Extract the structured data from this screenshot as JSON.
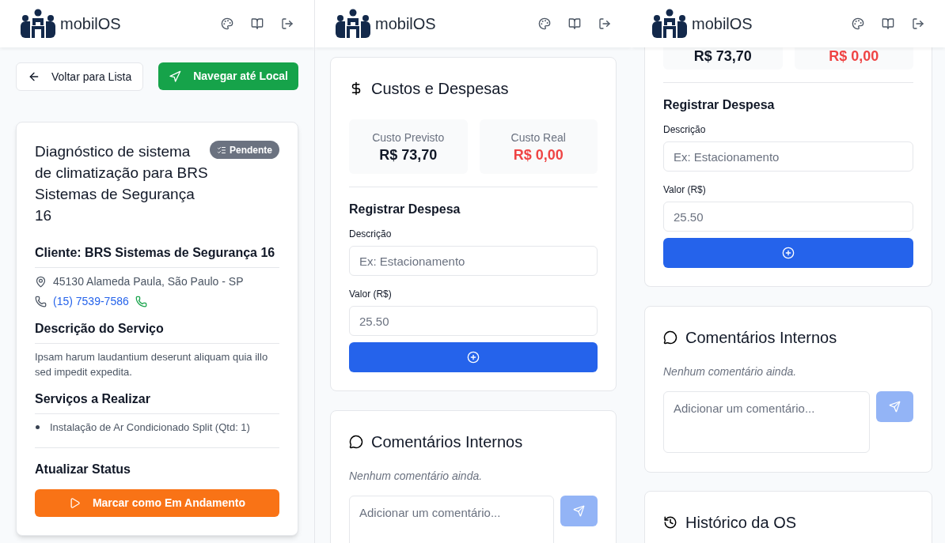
{
  "panels": [
    {
      "kind": "details",
      "app_name": "mobilOS",
      "back_button": "Voltar para Lista",
      "navigate_button": "Navegar até Local",
      "title": "Diagnóstico de sistema de climatização para BRS Sistemas de Segurança 16",
      "status_badge": "Pendente",
      "client": "Cliente: BRS Sistemas de Segurança 16",
      "address": "45130 Alameda Paula, São Paulo - SP",
      "phone": "(15) 7539-7586",
      "description_heading": "Descrição do Serviço",
      "description": "Ipsam harum laudantium deserunt aliquam quia illo sed impedit expedita.",
      "services_heading": "Serviços a Realizar",
      "services": [
        "Instalação de Ar Condicionado Split (Qtd: 1)"
      ],
      "status_heading": "Atualizar Status",
      "status_button": "Marcar como Em Andamento"
    },
    {
      "kind": "costs",
      "app_name": "mobilOS",
      "costs_title": "Custos e Despesas",
      "cost_boxes": [
        {
          "label": "Custo Previsto",
          "value": "R$ 73,70",
          "kind": "planned"
        },
        {
          "label": "Custo Real",
          "value": "R$ 0,00",
          "kind": "actual"
        }
      ],
      "expense_heading": "Registrar Despesa",
      "description_label": "Descrição",
      "description_placeholder": "Ex: Estacionamento",
      "value_label": "Valor (R$)",
      "value_placeholder": "25.50",
      "comments_title": "Comentários Internos",
      "comments_empty": "Nenhum comentário ainda.",
      "comment_placeholder": "Adicionar um comentário..."
    },
    {
      "kind": "costs_scrolled",
      "app_name": "mobilOS",
      "cost_boxes": [
        {
          "value": "R$ 73,70",
          "kind": "planned"
        },
        {
          "value": "R$ 0,00",
          "kind": "actual"
        }
      ],
      "expense_heading": "Registrar Despesa",
      "description_label": "Descrição",
      "description_placeholder": "Ex: Estacionamento",
      "value_label": "Valor (R$)",
      "value_placeholder": "25.50",
      "comments_title": "Comentários Internos",
      "comments_empty": "Nenhum comentário ainda.",
      "comment_placeholder": "Adicionar um comentário...",
      "history_title": "Histórico da OS"
    }
  ]
}
